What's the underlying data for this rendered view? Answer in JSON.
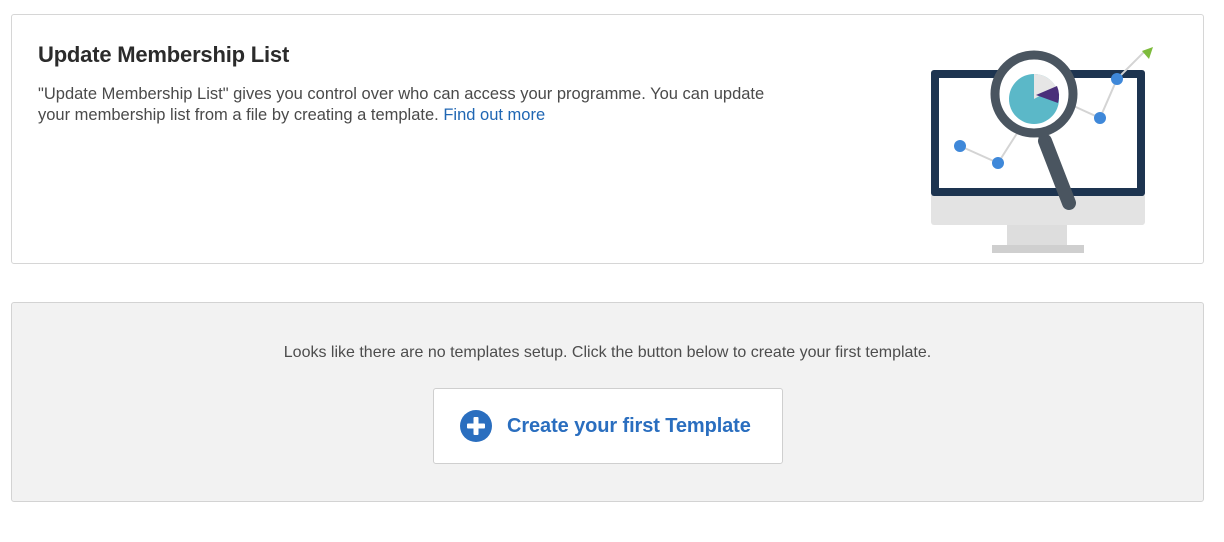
{
  "intro": {
    "title": "Update Membership List",
    "description": "\"Update Membership List\" gives you control over who can access your programme. You can update your membership list from a file by creating a template.",
    "link_label": "Find out more",
    "illustration_icon": "monitor-analytics-magnifier-icon"
  },
  "empty_state": {
    "message": "Looks like there are no templates setup. Click the button below to create your first template.",
    "button_label": "Create your first Template",
    "button_icon": "plus-circle-icon"
  },
  "colors": {
    "link": "#1f66b3",
    "button_text": "#2a6ebf",
    "panel_background": "#f2f2f2",
    "monitor_frame": "#1d3450",
    "magnifier": "#4a5560",
    "pie_teal": "#5bb8c8",
    "pie_purple": "#4a2f7a",
    "chart_dot": "#3f88d9",
    "arrow_green": "#7dbb3c"
  }
}
